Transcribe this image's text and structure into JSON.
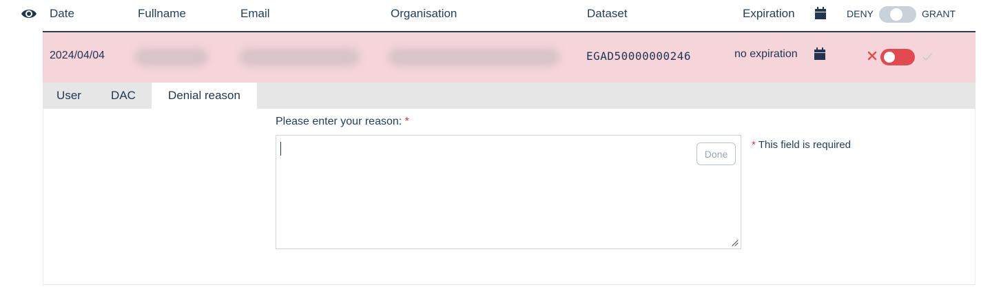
{
  "header": {
    "columns": {
      "date": "Date",
      "fullname": "Fullname",
      "email": "Email",
      "organisation": "Organisation",
      "dataset": "Dataset",
      "expiration": "Expiration"
    },
    "deny_label": "DENY",
    "grant_label": "GRANT"
  },
  "row": {
    "date": "2024/04/04",
    "dataset": "EGAD50000000246",
    "expiration": "no expiration",
    "decision": "deny"
  },
  "tabs": [
    {
      "label": "User",
      "active": false
    },
    {
      "label": "DAC",
      "active": false
    },
    {
      "label": "Denial reason",
      "active": true
    }
  ],
  "denial_form": {
    "label": "Please enter your reason:",
    "required_marker": "*",
    "value": "",
    "done_label": "Done",
    "error_marker": "*",
    "error_text": "This field is required"
  },
  "colors": {
    "row_background": "#f5d5d9",
    "deny_toggle": "#e34a4f",
    "text": "#1f3550",
    "required": "#d9343a"
  },
  "icons": [
    "eye-icon",
    "calendar-icon",
    "close-icon",
    "check-icon",
    "resize-handle-icon"
  ]
}
